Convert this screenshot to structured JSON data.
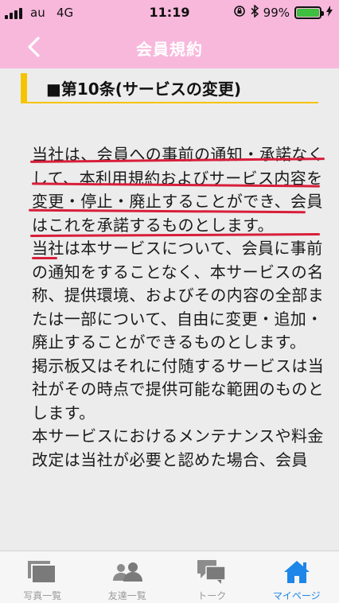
{
  "status_bar": {
    "carrier": "au",
    "network": "4G",
    "time": "11:19",
    "battery": "99%",
    "battery_level": 0.99
  },
  "nav": {
    "title": "会員規約",
    "back_icon": "chevron-left-icon"
  },
  "section": {
    "title": "■第10条(サービスの変更)"
  },
  "paragraphs": [
    "当社は、会員への事前の通知・承諾なくして、本利用規約およびサービス内容を変更・停止・廃止することができ、会員はこれを承諾するものとします。",
    "当社は本サービスについて、会員に事前の通知をすることなく、本サービスの名称、提供環境、およびその内容の全部または一部について、自由に変更・追加・廃止することができるものとします。",
    "掲示板又はそれに付随するサービスは当社がその時点で提供可能な範囲のものとします。",
    "本サービスにおけるメンテナンスや料金改定は当社が必要と認めた場合、会員"
  ],
  "tabs": [
    {
      "label": "写真一覧",
      "icon": "photos-icon",
      "active": false
    },
    {
      "label": "友達一覧",
      "icon": "friends-icon",
      "active": false
    },
    {
      "label": "トーク",
      "icon": "chat-icon",
      "active": false
    },
    {
      "label": "マイページ",
      "icon": "home-icon",
      "active": true
    }
  ],
  "colors": {
    "header": "#f8b8dc",
    "accent": "#f5c400",
    "underline": "#d81e3a",
    "active_tab": "#1e86e8"
  }
}
